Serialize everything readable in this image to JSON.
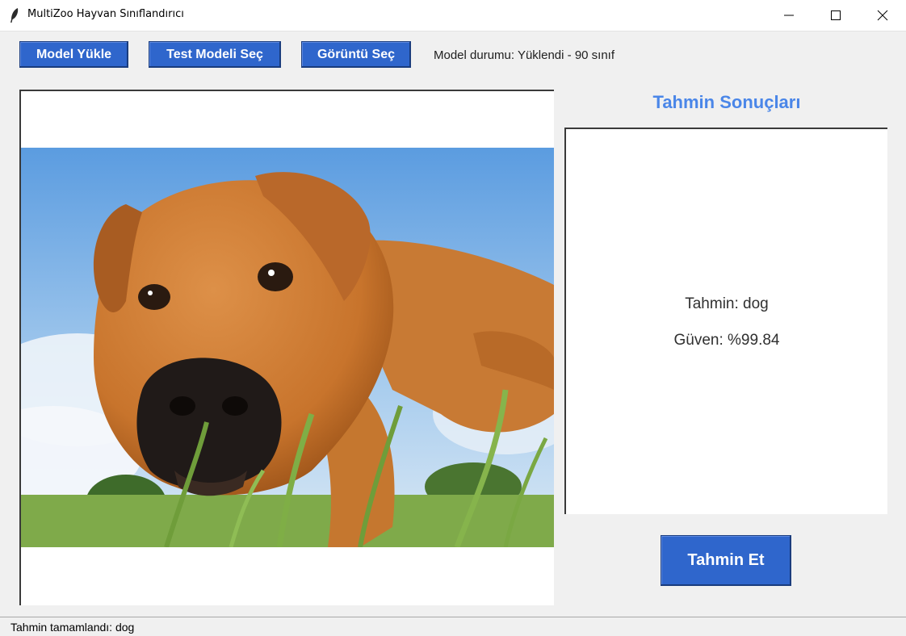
{
  "window": {
    "title": "MultiZoo Hayvan Sınıflandırıcı",
    "controls": [
      "minimize-icon",
      "maximize-icon",
      "close-icon"
    ]
  },
  "toolbar": {
    "load_model_label": "Model Yükle",
    "select_test_model_label": "Test Modeli Seç",
    "select_image_label": "Görüntü Seç",
    "model_status": "Model durumu: Yüklendi - 90 sınıf"
  },
  "image_panel": {
    "content": "dog photo"
  },
  "results": {
    "title": "Tahmin Sonuçları",
    "prediction": "Tahmin: dog",
    "confidence": "Güven: %99.84",
    "predict_button_label": "Tahmin Et"
  },
  "statusbar": {
    "text": "Tahmin tamamlandı: dog"
  },
  "colors": {
    "button_bg": "#2f66cc",
    "accent_title": "#4a86e8",
    "window_bg": "#f0f0f0"
  }
}
